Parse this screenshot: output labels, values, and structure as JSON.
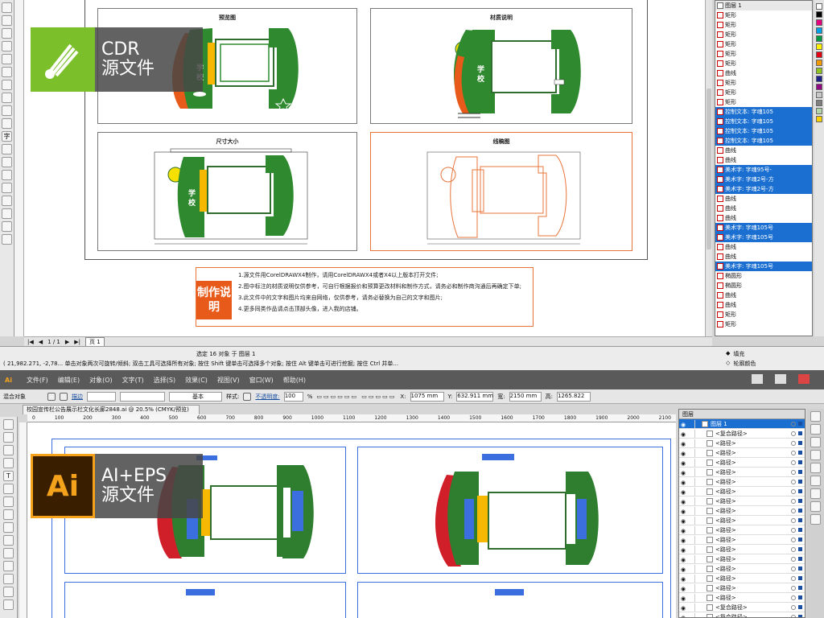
{
  "cdr": {
    "badge": {
      "line1": "CDR",
      "line2": "源文件"
    },
    "panels": [
      {
        "caption": "预览图"
      },
      {
        "caption": "材质说明"
      },
      {
        "caption": "尺寸大小"
      },
      {
        "caption": "线稿图"
      }
    ],
    "sign_text": "学校宣传栏",
    "instructions": {
      "title": "制作说明",
      "lines": [
        "1.源文件用CorelDRAWX4制作，请用CorelDRAWX4或者X4以上版本打开文件;",
        "2.图中标注的材质说明仅供参考，可自行根据报价和预算更改材料和制作方式，请务必和制作商沟通后再确定下单;",
        "3.此文件中的文字和图片均来自网络，仅供参考，请务必替换为自己的文字和图片;",
        "4.更多同类作品请点击顶部头像，进入我的店铺。"
      ]
    },
    "pagebar": {
      "pages": "1 / 1",
      "tab": "页 1"
    },
    "status": {
      "selection": "选定 16 对象 于 图层 1",
      "coords": "( 21,982.271, -2,78... 单击对象两次可旋转/倾斜; 双击工具可选择所有对象; 按住 Shift 键单击可选择多个对象; 按住 Alt 键单击可进行挖掘; 按住 Ctrl 并单...",
      "fill": "填充",
      "outline": "轮廓颜色"
    },
    "objects": [
      {
        "label": "矩形",
        "sel": false
      },
      {
        "label": "矩形",
        "sel": false
      },
      {
        "label": "矩形",
        "sel": false
      },
      {
        "label": "矩形",
        "sel": false
      },
      {
        "label": "矩形",
        "sel": false
      },
      {
        "label": "矩形",
        "sel": false
      },
      {
        "label": "曲线",
        "sel": false
      },
      {
        "label": "矩形",
        "sel": false
      },
      {
        "label": "矩形",
        "sel": false
      },
      {
        "label": "矩形",
        "sel": false
      },
      {
        "label": "控制文本: 字魂105",
        "sel": true
      },
      {
        "label": "控制文本: 字魂105",
        "sel": true
      },
      {
        "label": "控制文本: 字魂105",
        "sel": true
      },
      {
        "label": "控制文本: 字魂105",
        "sel": true
      },
      {
        "label": "曲线",
        "sel": false
      },
      {
        "label": "曲线",
        "sel": false
      },
      {
        "label": "美术字: 字魂95号-",
        "sel": true
      },
      {
        "label": "美术字: 字魂2号-方",
        "sel": true
      },
      {
        "label": "美术字: 字魂2号-方",
        "sel": true
      },
      {
        "label": "曲线",
        "sel": false
      },
      {
        "label": "曲线",
        "sel": false
      },
      {
        "label": "曲线",
        "sel": false
      },
      {
        "label": "美术字: 字魂105号",
        "sel": true
      },
      {
        "label": "美术字: 字魂105号",
        "sel": true
      },
      {
        "label": "曲线",
        "sel": false
      },
      {
        "label": "曲线",
        "sel": false
      },
      {
        "label": "美术字: 字魂105号",
        "sel": true
      },
      {
        "label": "椭圆形",
        "sel": false
      },
      {
        "label": "椭圆形",
        "sel": false
      },
      {
        "label": "曲线",
        "sel": false
      },
      {
        "label": "曲线",
        "sel": false
      },
      {
        "label": "矩形",
        "sel": false
      },
      {
        "label": "矩形",
        "sel": false
      }
    ],
    "panel_top_label": "图层 1",
    "palette": [
      "#ffffff",
      "#000000",
      "#e6007e",
      "#00a0e9",
      "#009944",
      "#fff100",
      "#e60012",
      "#f39800",
      "#8fc31f",
      "#1d2088",
      "#920783",
      "#c8c8c8",
      "#808080",
      "#b5d7a7",
      "#fdd000"
    ]
  },
  "ai": {
    "badge": {
      "line1": "AI+EPS",
      "line2": "源文件"
    },
    "menu": [
      "文件(F)",
      "编辑(E)",
      "对象(O)",
      "文字(T)",
      "选择(S)",
      "效果(C)",
      "视图(V)",
      "窗口(W)",
      "帮助(H)"
    ],
    "app_tag": "Ai",
    "control": {
      "mode": "混合对象",
      "stroke_label": "描边",
      "basic": "基本",
      "style_label": "样式:",
      "opacity_label": "不透明度:",
      "opacity": "100",
      "pct": "%",
      "x_label": "X:",
      "x": "1075 mm",
      "y_label": "Y:",
      "y": "632.911 mm",
      "w_label": "宽:",
      "w": "2150 mm",
      "h_label": "高:",
      "h": "1265.822"
    },
    "doc_tab": "校园宣传栏公告展示栏文化长廊2848.ai @ 20.5% (CMYK/预览)",
    "ruler": [
      "0",
      "100",
      "200",
      "300",
      "400",
      "500",
      "600",
      "700",
      "800",
      "900",
      "1000",
      "1100",
      "1200",
      "1300",
      "1400",
      "1500",
      "1600",
      "1700",
      "1800",
      "1900",
      "2000",
      "2100"
    ],
    "layers_tab": "图层",
    "layers": [
      {
        "label": "图层 1",
        "top": true
      },
      {
        "label": "<复合路径>",
        "top": false
      },
      {
        "label": "<路径>",
        "top": false
      },
      {
        "label": "<路径>",
        "top": false
      },
      {
        "label": "<路径>",
        "top": false
      },
      {
        "label": "<路径>",
        "top": false
      },
      {
        "label": "<路径>",
        "top": false
      },
      {
        "label": "<路径>",
        "top": false
      },
      {
        "label": "<路径>",
        "top": false
      },
      {
        "label": "<路径>",
        "top": false
      },
      {
        "label": "<路径>",
        "top": false
      },
      {
        "label": "<路径>",
        "top": false
      },
      {
        "label": "<路径>",
        "top": false
      },
      {
        "label": "<路径>",
        "top": false
      },
      {
        "label": "<路径>",
        "top": false
      },
      {
        "label": "<路径>",
        "top": false
      },
      {
        "label": "<路径>",
        "top": false
      },
      {
        "label": "<路径>",
        "top": false
      },
      {
        "label": "<路径>",
        "top": false
      },
      {
        "label": "<复合路径>",
        "top": false
      },
      {
        "label": "<复合路径>",
        "top": false
      },
      {
        "label": "<复合路径>",
        "top": false
      }
    ]
  }
}
